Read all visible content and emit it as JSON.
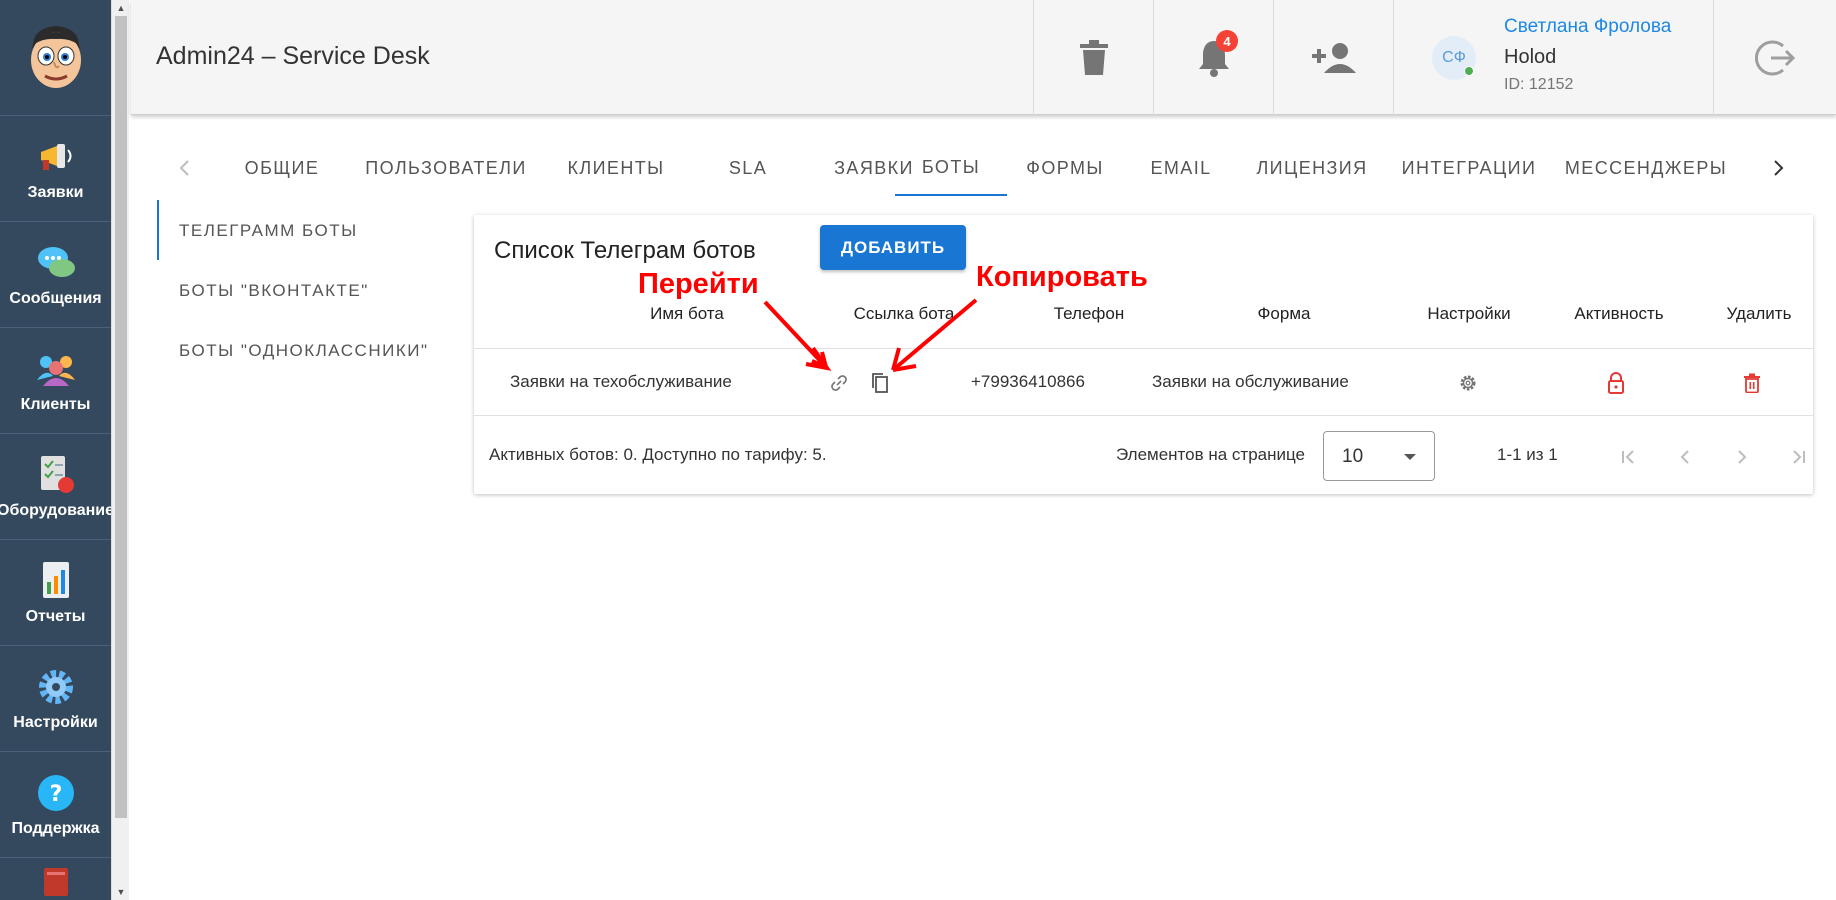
{
  "app": {
    "title": "Admin24 – Service Desk"
  },
  "sidebar": {
    "items": [
      {
        "label": "Заявки",
        "icon": "megaphone-icon"
      },
      {
        "label": "Сообщения",
        "icon": "chat-bubbles-icon"
      },
      {
        "label": "Клиенты",
        "icon": "clients-group-icon"
      },
      {
        "label": "Оборудование",
        "icon": "equipment-checklist-icon"
      },
      {
        "label": "Отчеты",
        "icon": "report-chart-icon"
      },
      {
        "label": "Настройки",
        "icon": "gear-icon"
      },
      {
        "label": "Поддержка",
        "icon": "help-question-icon"
      }
    ]
  },
  "header": {
    "notifications_count": "4",
    "user": {
      "initials": "СФ",
      "name": "Светлана Фролова",
      "company": "Holod",
      "id": "ID: 12152"
    }
  },
  "tabs": [
    {
      "label": "ОБЩИЕ"
    },
    {
      "label": "ПОЛЬЗОВАТЕЛИ"
    },
    {
      "label": "КЛИЕНТЫ"
    },
    {
      "label": "SLA"
    },
    {
      "label": "ЗАЯВКИ"
    },
    {
      "label": "БОТЫ",
      "active": true
    },
    {
      "label": "ФОРМЫ"
    },
    {
      "label": "EMAIL"
    },
    {
      "label": "ЛИЦЕНЗИЯ"
    },
    {
      "label": "ИНТЕГРАЦИИ"
    },
    {
      "label": "МЕССЕНДЖЕРЫ"
    }
  ],
  "subnav": [
    {
      "label": "ТЕЛЕГРАММ БОТЫ",
      "active": true
    },
    {
      "label": "БОТЫ \"ВКОНТАКТЕ\""
    },
    {
      "label": "БОТЫ \"ОДНОКЛАССНИКИ\""
    }
  ],
  "card": {
    "title": "Список Телеграм ботов",
    "add_label": "ДОБАВИТЬ",
    "columns": [
      "Имя бота",
      "Ссылка бота",
      "Телефон",
      "Форма",
      "Настройки",
      "Активность",
      "Удалить"
    ],
    "rows": [
      {
        "name": "Заявки на техобслуживание",
        "phone": "+79936410866",
        "form": "Заявки на обслуживание"
      }
    ],
    "footer": {
      "summary": "Активных ботов: 0. Доступно по тарифу: 5.",
      "per_page_label": "Элементов на странице",
      "per_page_value": "10",
      "range": "1-1 из 1"
    }
  },
  "annotations": {
    "go": "Перейти",
    "copy": "Копировать"
  },
  "colors": {
    "primary": "#1976d2",
    "danger": "#e53935",
    "annotation": "#ff0000",
    "sidebar": "#34495e"
  }
}
